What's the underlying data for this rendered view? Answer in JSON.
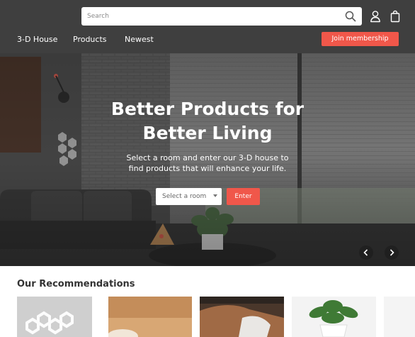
{
  "header": {
    "search": {
      "placeholder": "Search",
      "value": ""
    },
    "icons": [
      "search-icon",
      "user-icon",
      "shopping-bag-icon"
    ],
    "nav": [
      "3-D House",
      "Products",
      "Newest"
    ],
    "join_label": "Join membership"
  },
  "hero": {
    "title_line1": "Better Products for",
    "title_line2": "Better Living",
    "subtitle_line1": "Select a room and enter our 3-D house to",
    "subtitle_line2": "find products that will enhance your life.",
    "room_select_value": "Select a room",
    "enter_label": "Enter",
    "prev_icon": "chevron-left-icon",
    "next_icon": "chevron-right-icon"
  },
  "recommendations": {
    "title": "Our Recommendations",
    "cards": [
      {
        "image": "hexagon-lights"
      },
      {
        "image": "wood-lamp"
      },
      {
        "image": "car-interior"
      },
      {
        "image": "potted-plant"
      }
    ]
  },
  "colors": {
    "header_bg": "#3f3f3f",
    "accent": "#f0574a",
    "text_dark": "#333333"
  }
}
